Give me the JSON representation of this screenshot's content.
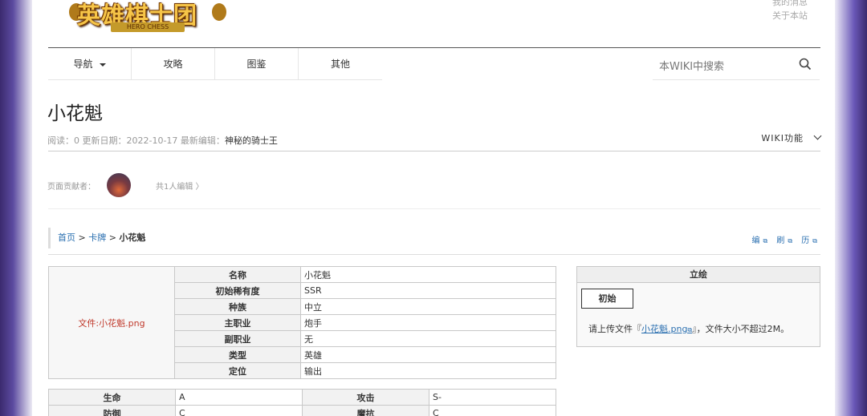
{
  "header": {
    "logo_title": "英雄棋士团",
    "logo_sub": "HERO CHESS",
    "links": [
      "我的消息",
      "关于本站"
    ]
  },
  "nav": {
    "items": [
      "导航",
      "攻略",
      "图鉴",
      "其他"
    ],
    "search_placeholder": "本WIKI中搜索"
  },
  "page": {
    "title": "小花魁",
    "meta_prefix": "阅读：0  更新日期：2022-10-17  最新编辑：",
    "meta_editor": "神秘的骑士王",
    "wiki_fn": "WIKI功能",
    "contributors_label": "页面贡献者：",
    "editors_count": "共1人编辑 〉"
  },
  "breadcrumb": {
    "home": "首页",
    "sep": " > ",
    "category": "卡牌",
    "current": "小花魁"
  },
  "tools": [
    "编",
    "刷",
    "历"
  ],
  "infobox": {
    "image_link": "文件:小花魁.png",
    "rows": [
      {
        "k": "名称",
        "v": "小花魁"
      },
      {
        "k": "初始稀有度",
        "v": "SSR"
      },
      {
        "k": "种族",
        "v": "中立"
      },
      {
        "k": "主职业",
        "v": "炮手"
      },
      {
        "k": "副职业",
        "v": "无"
      },
      {
        "k": "类型",
        "v": "英雄"
      },
      {
        "k": "定位",
        "v": "输出"
      }
    ]
  },
  "stats": [
    {
      "k1": "生命",
      "v1": "A",
      "k2": "攻击",
      "v2": "S-"
    },
    {
      "k1": "防御",
      "v1": "C",
      "k2": "魔抗",
      "v2": "C"
    }
  ],
  "portrait": {
    "header": "立绘",
    "tab": "初始",
    "msg_pre": "请上传文件『",
    "msg_link": "小花魁.png",
    "msg_post": "』，文件大小不超过2M。"
  }
}
